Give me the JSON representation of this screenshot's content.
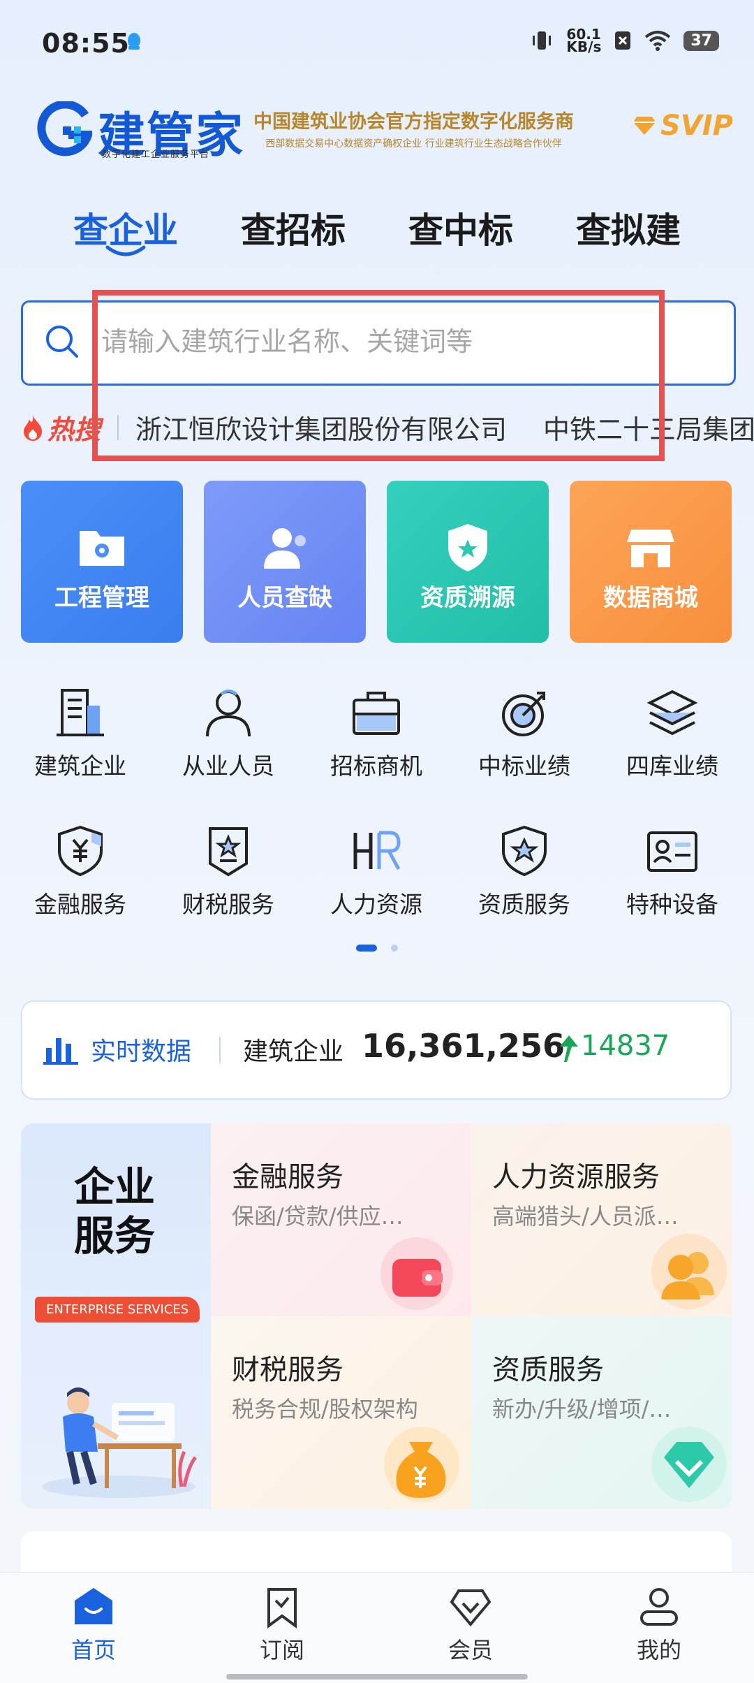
{
  "status_bar": {
    "time": "08:55",
    "network_speed": "60.1\nKB/s",
    "battery": "37"
  },
  "header": {
    "logo_name": "建管家",
    "logo_sub": "数字化建工企业服务平台",
    "slogan_line1": "中国建筑业协会官方指定数字化服务商",
    "slogan_line2": "西部数据交易中心数据资产确权企业    行业建筑行业生态战略合作伙伴",
    "svip_label": "SVIP"
  },
  "tabs": [
    {
      "label": "查企业",
      "active": true
    },
    {
      "label": "查招标",
      "active": false
    },
    {
      "label": "查中标",
      "active": false
    },
    {
      "label": "查拟建",
      "active": false
    }
  ],
  "search": {
    "placeholder": "请输入建筑行业名称、关键词等",
    "value": ""
  },
  "hot_search": {
    "label": "热搜",
    "items": [
      "浙江恒欣设计集团股份有限公司",
      "中铁二十三局集团"
    ]
  },
  "feature_cards": [
    {
      "label": "工程管理",
      "color": "#3e86f5"
    },
    {
      "label": "人员查缺",
      "color": "#6f8ef7"
    },
    {
      "label": "资质溯源",
      "color": "#2cc7b2"
    },
    {
      "label": "数据商城",
      "color": "#fb9a48"
    }
  ],
  "grid_items": [
    {
      "label": "建筑企业",
      "icon": "building-icon"
    },
    {
      "label": "从业人员",
      "icon": "person-icon"
    },
    {
      "label": "招标商机",
      "icon": "briefcase-icon"
    },
    {
      "label": "中标业绩",
      "icon": "target-icon"
    },
    {
      "label": "四库业绩",
      "icon": "layers-icon"
    },
    {
      "label": "金融服务",
      "icon": "yuan-shield-icon"
    },
    {
      "label": "财税服务",
      "icon": "tax-badge-icon"
    },
    {
      "label": "人力资源",
      "icon": "hr-icon"
    },
    {
      "label": "资质服务",
      "icon": "star-shield-icon"
    },
    {
      "label": "特种设备",
      "icon": "id-card-icon"
    }
  ],
  "realtime": {
    "title": "实时数据",
    "category": "建筑企业",
    "total": "16,361,256",
    "increase": "14837"
  },
  "enterprise_services": {
    "title_line1": "企业",
    "title_line2": "服务",
    "badge": "ENTERPRISE SERVICES",
    "items": [
      {
        "title": "金融服务",
        "subtitle": "保函/贷款/供应…"
      },
      {
        "title": "人力资源服务",
        "subtitle": "高端猎头/人员派…"
      },
      {
        "title": "财税服务",
        "subtitle": "税务合规/股权架构"
      },
      {
        "title": "资质服务",
        "subtitle": "新办/升级/增项/…"
      }
    ]
  },
  "bottom_nav": [
    {
      "label": "首页",
      "active": true
    },
    {
      "label": "订阅",
      "active": false
    },
    {
      "label": "会员",
      "active": false
    },
    {
      "label": "我的",
      "active": false
    }
  ]
}
